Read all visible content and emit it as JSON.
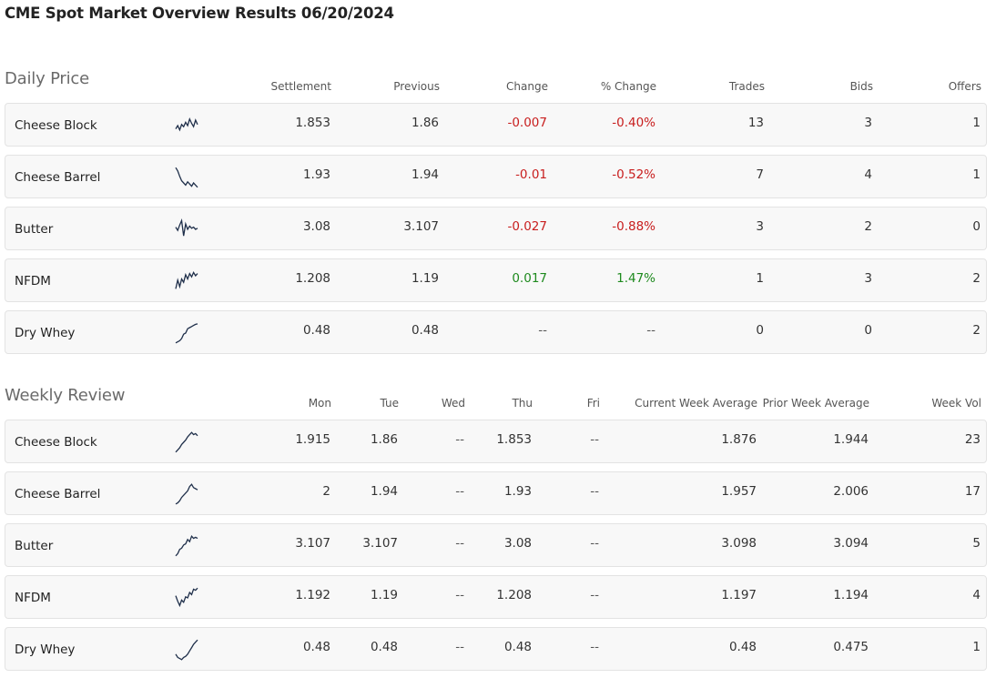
{
  "page_title": "CME Spot Market Overview Results 06/20/2024",
  "daily": {
    "title": "Daily Price",
    "headers": [
      "Settlement",
      "Previous",
      "Change",
      "% Change",
      "Trades",
      "Bids",
      "Offers"
    ],
    "rows": [
      {
        "name": "Cheese Block",
        "settlement": "1.853",
        "previous": "1.86",
        "change": "-0.007",
        "pct_change": "-0.40%",
        "trades": "13",
        "bids": "3",
        "offers": "1",
        "trend": "negative",
        "spark": [
          0.35,
          0.5,
          0.3,
          0.55,
          0.45,
          0.65,
          0.5,
          0.8,
          0.6,
          0.45,
          0.75,
          0.55
        ]
      },
      {
        "name": "Cheese Barrel",
        "settlement": "1.93",
        "previous": "1.94",
        "change": "-0.01",
        "pct_change": "-0.52%",
        "trades": "7",
        "bids": "4",
        "offers": "1",
        "trend": "negative",
        "spark": [
          0.95,
          0.8,
          0.55,
          0.35,
          0.25,
          0.15,
          0.3,
          0.2,
          0.1,
          0.25,
          0.15,
          0.05
        ]
      },
      {
        "name": "Butter",
        "settlement": "3.08",
        "previous": "3.107",
        "change": "-0.027",
        "pct_change": "-0.88%",
        "trades": "3",
        "bids": "2",
        "offers": "0",
        "trend": "negative",
        "spark": [
          0.6,
          0.45,
          0.7,
          0.9,
          0.2,
          0.75,
          0.5,
          0.65,
          0.55,
          0.6,
          0.5,
          0.55
        ]
      },
      {
        "name": "NFDM",
        "settlement": "1.208",
        "previous": "1.19",
        "change": "0.017",
        "pct_change": "1.47%",
        "trades": "1",
        "bids": "3",
        "offers": "2",
        "trend": "positive",
        "spark": [
          0.15,
          0.55,
          0.25,
          0.6,
          0.45,
          0.8,
          0.6,
          0.85,
          0.7,
          0.9,
          0.75,
          0.85
        ]
      },
      {
        "name": "Dry Whey",
        "settlement": "0.48",
        "previous": "0.48",
        "change": "--",
        "pct_change": "--",
        "trades": "0",
        "bids": "0",
        "offers": "2",
        "trend": "neutral",
        "spark": [
          0.05,
          0.1,
          0.15,
          0.25,
          0.45,
          0.5,
          0.7,
          0.75,
          0.8,
          0.85,
          0.9,
          0.92
        ]
      }
    ]
  },
  "weekly": {
    "title": "Weekly Review",
    "headers": [
      "Mon",
      "Tue",
      "Wed",
      "Thu",
      "Fri",
      "Current Week Average",
      "Prior Week Average",
      "Week Vol"
    ],
    "rows": [
      {
        "name": "Cheese Block",
        "mon": "1.915",
        "tue": "1.86",
        "wed": "--",
        "thu": "1.853",
        "fri": "--",
        "cur_avg": "1.876",
        "prior_avg": "1.944",
        "week_vol": "23",
        "spark": [
          0.05,
          0.15,
          0.25,
          0.4,
          0.5,
          0.6,
          0.75,
          0.85,
          0.95,
          0.85,
          0.9,
          0.8
        ]
      },
      {
        "name": "Cheese Barrel",
        "mon": "2",
        "tue": "1.94",
        "wed": "--",
        "thu": "1.93",
        "fri": "--",
        "cur_avg": "1.957",
        "prior_avg": "2.006",
        "week_vol": "17",
        "spark": [
          0.05,
          0.1,
          0.2,
          0.35,
          0.45,
          0.55,
          0.65,
          0.85,
          0.95,
          0.8,
          0.75,
          0.7
        ]
      },
      {
        "name": "Butter",
        "mon": "3.107",
        "tue": "3.107",
        "wed": "--",
        "thu": "3.08",
        "fri": "--",
        "cur_avg": "3.098",
        "prior_avg": "3.094",
        "week_vol": "5",
        "spark": [
          0.05,
          0.15,
          0.35,
          0.4,
          0.55,
          0.6,
          0.8,
          0.7,
          0.95,
          0.85,
          0.9,
          0.85
        ]
      },
      {
        "name": "NFDM",
        "mon": "1.192",
        "tue": "1.19",
        "wed": "--",
        "thu": "1.208",
        "fri": "--",
        "cur_avg": "1.197",
        "prior_avg": "1.194",
        "week_vol": "4",
        "spark": [
          0.6,
          0.35,
          0.15,
          0.4,
          0.3,
          0.55,
          0.5,
          0.75,
          0.65,
          0.9,
          0.85,
          0.95
        ]
      },
      {
        "name": "Dry Whey",
        "mon": "0.48",
        "tue": "0.48",
        "wed": "--",
        "thu": "0.48",
        "fri": "--",
        "cur_avg": "0.48",
        "prior_avg": "0.475",
        "week_vol": "1",
        "spark": [
          0.3,
          0.15,
          0.1,
          0.05,
          0.15,
          0.2,
          0.3,
          0.45,
          0.6,
          0.75,
          0.85,
          0.95
        ]
      }
    ]
  },
  "colors": {
    "negative": "#c81e1e",
    "positive": "#1e8a1e",
    "spark_line": "#1f2f4a"
  }
}
